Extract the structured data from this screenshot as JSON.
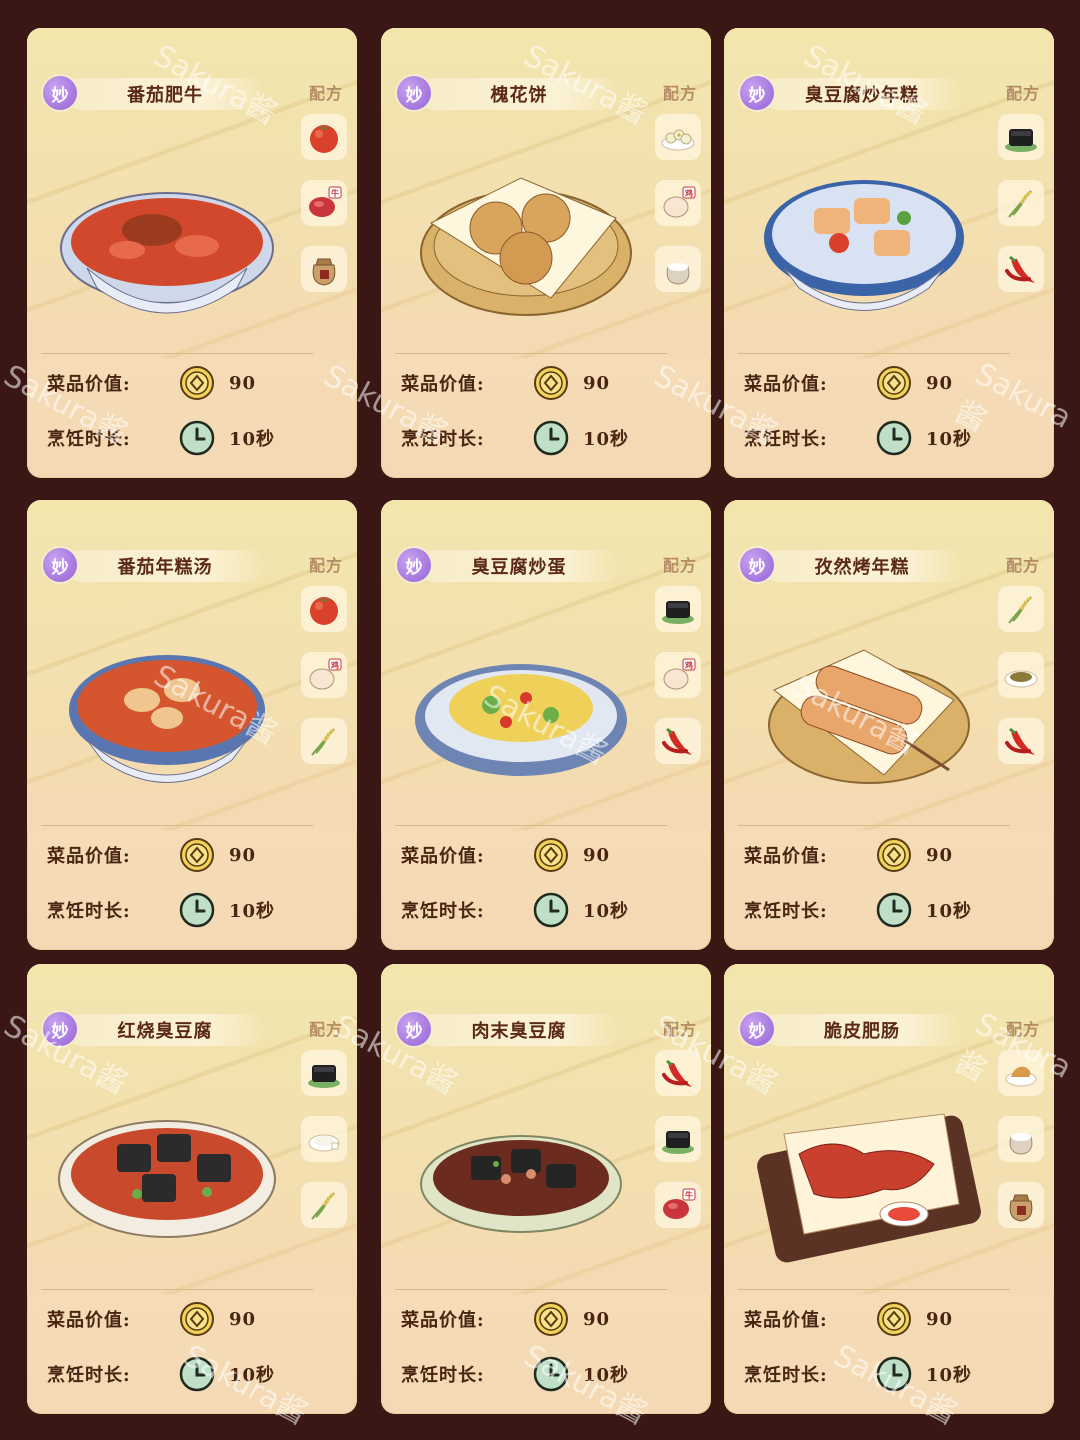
{
  "recipe_label": "配方",
  "value_label": "菜品价值:",
  "time_label": "烹饪时长:",
  "badge_char": "妙",
  "watermark": "Sakura酱",
  "cards": [
    {
      "name": "番茄肥牛",
      "value": "90",
      "time": "10秒",
      "dish": "red-stew-bowl",
      "ingredients": [
        "tomato-icon",
        "beef-icon",
        "seasoning-bag-icon"
      ]
    },
    {
      "name": "槐花饼",
      "value": "90",
      "time": "10秒",
      "dish": "pancake-basket",
      "ingredients": [
        "flower-icon",
        "egg-icon",
        "flour-icon"
      ]
    },
    {
      "name": "臭豆腐炒年糕",
      "value": "90",
      "time": "10秒",
      "dish": "ricecake-bowl",
      "ingredients": [
        "stinky-tofu-icon",
        "rice-stalk-icon",
        "chili-icon"
      ]
    },
    {
      "name": "番茄年糕汤",
      "value": "90",
      "time": "10秒",
      "dish": "soup-bowl",
      "ingredients": [
        "tomato-icon",
        "egg-icon",
        "rice-stalk-icon"
      ]
    },
    {
      "name": "臭豆腐炒蛋",
      "value": "90",
      "time": "10秒",
      "dish": "egg-plate",
      "ingredients": [
        "stinky-tofu-icon",
        "egg-icon",
        "chili-icon"
      ]
    },
    {
      "name": "孜然烤年糕",
      "value": "90",
      "time": "10秒",
      "dish": "skewer-basket",
      "ingredients": [
        "rice-stalk-icon",
        "cumin-icon",
        "chili-icon"
      ]
    },
    {
      "name": "红烧臭豆腐",
      "value": "90",
      "time": "10秒",
      "dish": "dark-tofu-bowl",
      "ingredients": [
        "stinky-tofu-icon",
        "sugar-icon",
        "rice-stalk-icon"
      ]
    },
    {
      "name": "肉末臭豆腐",
      "value": "90",
      "time": "10秒",
      "dish": "minced-tofu-plate",
      "ingredients": [
        "chili-icon",
        "stinky-tofu-icon",
        "beef-icon"
      ]
    },
    {
      "name": "脆皮肥肠",
      "value": "90",
      "time": "10秒",
      "dish": "intestine-board",
      "ingredients": [
        "meat-icon",
        "flour-icon",
        "seasoning-bag-icon"
      ]
    }
  ]
}
